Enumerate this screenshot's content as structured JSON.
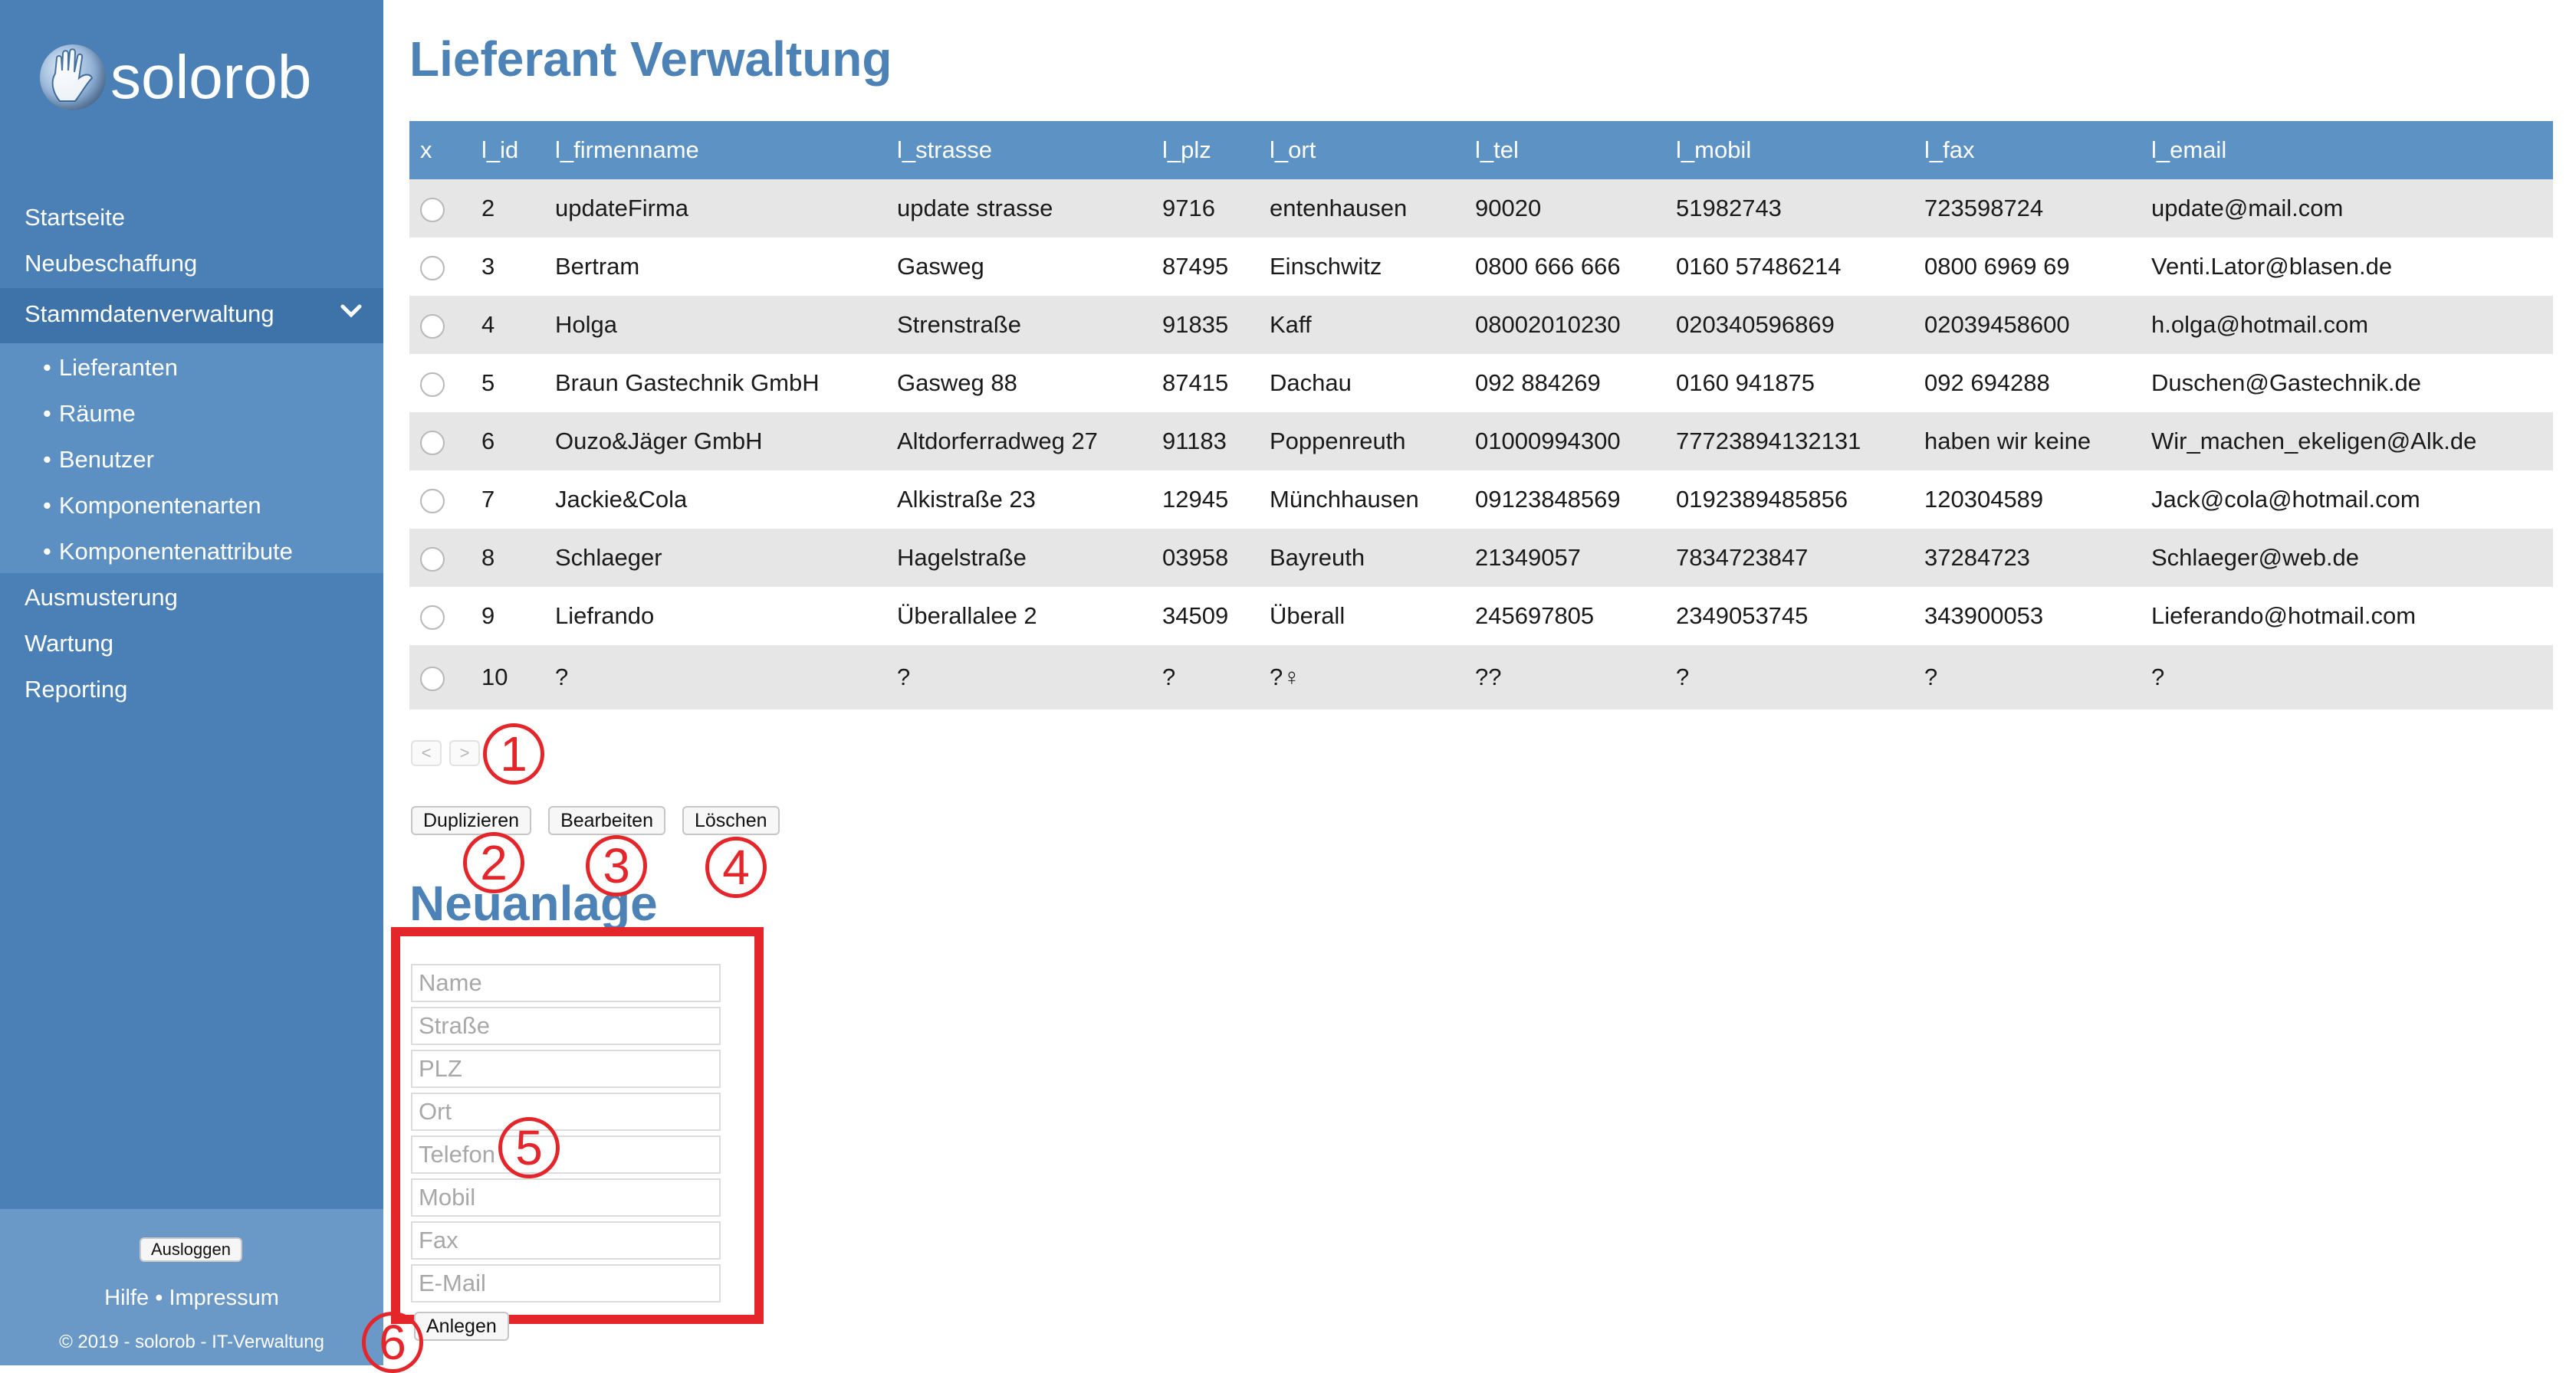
{
  "brand": {
    "logo_text": "solorob"
  },
  "sidebar": {
    "nav": [
      {
        "label": "Startseite"
      },
      {
        "label": "Neubeschaffung"
      },
      {
        "label": "Stammdatenverwaltung"
      },
      {
        "label": "Ausmusterung"
      },
      {
        "label": "Wartung"
      },
      {
        "label": "Reporting"
      }
    ],
    "sub_items": [
      {
        "label": "Lieferanten"
      },
      {
        "label": "Räume"
      },
      {
        "label": "Benutzer"
      },
      {
        "label": "Komponentenarten"
      },
      {
        "label": "Komponentenattribute"
      }
    ],
    "bullet": "•",
    "logout_label": "Ausloggen",
    "help_label": "Hilfe",
    "separator": "•",
    "imprint_label": "Impressum",
    "copyright": "© 2019 - solorob - IT-Verwaltung"
  },
  "main": {
    "title": "Lieferant Verwaltung",
    "table": {
      "columns": [
        "x",
        "l_id",
        "l_firmenname",
        "l_strasse",
        "l_plz",
        "l_ort",
        "l_tel",
        "l_mobil",
        "l_fax",
        "l_email"
      ],
      "rows": [
        [
          "2",
          "updateFirma",
          "update strasse",
          "9716",
          "entenhausen",
          "90020",
          "51982743",
          "723598724",
          "update@mail.com"
        ],
        [
          "3",
          "Bertram",
          "Gasweg",
          "87495",
          "Einschwitz",
          "0800 666 666",
          "0160 57486214",
          "0800 6969 69",
          "Venti.Lator@blasen.de"
        ],
        [
          "4",
          "Holga",
          "Strenstraße",
          "91835",
          "Kaff",
          "08002010230",
          "020340596869",
          "02039458600",
          "h.olga@hotmail.com"
        ],
        [
          "5",
          "Braun Gastechnik GmbH",
          "Gasweg 88",
          "87415",
          "Dachau",
          "092 884269",
          "0160 941875",
          "092 694288",
          "Duschen@Gastechnik.de"
        ],
        [
          "6",
          "Ouzo&Jäger GmbH",
          "Altdorferradweg 27",
          "91183",
          "Poppenreuth",
          "01000994300",
          "77723894132131",
          "haben wir keine",
          "Wir_machen_ekeligen@Alk.de"
        ],
        [
          "7",
          "Jackie&Cola",
          "Alkistraße 23",
          "12945",
          "Münchhausen",
          "09123848569",
          "0192389485856",
          "120304589",
          "Jack@cola@hotmail.com"
        ],
        [
          "8",
          "Schlaeger",
          "Hagelstraße",
          "03958",
          "Bayreuth",
          "21349057",
          "7834723847",
          "37284723",
          "Schlaeger@web.de"
        ],
        [
          "9",
          "Liefrando",
          "Überallalee 2",
          "34509",
          "Überall",
          "245697805",
          "2349053745",
          "343900053",
          "Lieferando@hotmail.com"
        ],
        [
          "10",
          "?",
          "?",
          "?",
          "?♀",
          "??",
          "?",
          "?",
          "?"
        ]
      ]
    },
    "pager": {
      "prev": "<",
      "next": ">"
    },
    "actions": {
      "duplicate": "Duplizieren",
      "edit": "Bearbeiten",
      "delete": "Löschen"
    },
    "new_section": {
      "title": "Neuanlage",
      "placeholders": [
        "Name",
        "Straße",
        "PLZ",
        "Ort",
        "Telefon",
        "Mobil",
        "Fax",
        "E-Mail"
      ],
      "create_label": "Anlegen"
    }
  },
  "annotations": {
    "markers": [
      "1",
      "2",
      "3",
      "4",
      "5",
      "6"
    ],
    "color": "#e4262a"
  },
  "colors": {
    "sidebar": "#4a80b5",
    "title": "#4d82b6",
    "table_header": "#5d92c4",
    "row_shade": "#e6e6e6"
  }
}
